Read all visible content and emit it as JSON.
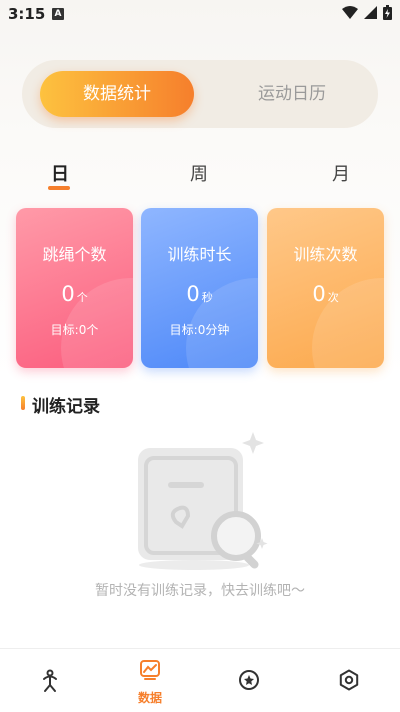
{
  "status_bar": {
    "time": "3:15",
    "notification_icon_letter": "A",
    "icons": [
      "wifi-icon",
      "signal-icon",
      "battery-charging-icon"
    ]
  },
  "segment": {
    "tabs": [
      {
        "label": "数据统计",
        "active": true
      },
      {
        "label": "运动日历",
        "active": false
      }
    ],
    "accent_gradient": [
      "#fdc23f",
      "#f67f2c"
    ]
  },
  "period_tabs": [
    {
      "label": "日",
      "active": true
    },
    {
      "label": "周",
      "active": false
    },
    {
      "label": "月",
      "active": false
    }
  ],
  "cards": [
    {
      "title": "跳绳个数",
      "value": "0",
      "unit": "个",
      "goal": "目标:0个",
      "color": "#fb5d7e"
    },
    {
      "title": "训练时长",
      "value": "0",
      "unit": "秒",
      "goal": "目标:0分钟",
      "color": "#4d88f8"
    },
    {
      "title": "训练次数",
      "value": "0",
      "unit": "次",
      "goal": "",
      "color": "#fca94d"
    }
  ],
  "records": {
    "title": "训练记录",
    "empty_text": "暂时没有训练记录，快去训练吧～"
  },
  "bottom_nav": [
    {
      "icon": "jump-rope-icon",
      "label": "",
      "active": false
    },
    {
      "icon": "chart-icon",
      "label": "数据",
      "active": true
    },
    {
      "icon": "medal-icon",
      "label": "",
      "active": false
    },
    {
      "icon": "settings-icon",
      "label": "",
      "active": false
    }
  ]
}
